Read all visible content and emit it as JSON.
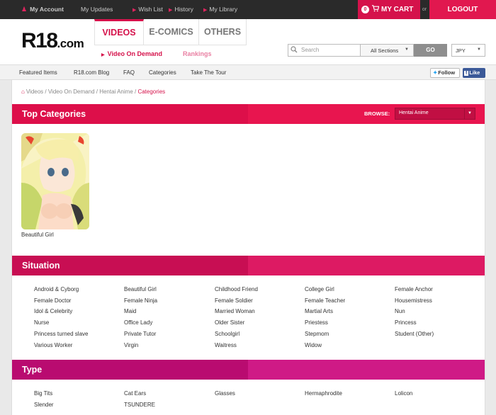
{
  "topbar": {
    "my_account": "My Account",
    "my_updates": "My Updates",
    "wish_list": "Wish List",
    "history": "History",
    "my_library": "My Library",
    "cart_count": "0",
    "my_cart": "MY CART",
    "or": "or",
    "logout": "LOGOUT"
  },
  "header": {
    "logo_main": "R18",
    "logo_suffix": ".com",
    "tabs": [
      "VIDEOS",
      "E-COMICS",
      "OTHERS"
    ],
    "subnav": [
      "Video On Demand",
      "Rankings"
    ],
    "search_placeholder": "Search",
    "section_select": "All Sections",
    "go_button": "GO",
    "currency": "JPY"
  },
  "secnav": {
    "items": [
      "Featured Items",
      "R18.com Blog",
      "FAQ",
      "Categories",
      "Take The Tour"
    ],
    "follow": "Follow",
    "like": "Like"
  },
  "breadcrumb": [
    "Videos",
    "Video On Demand",
    "Hentai Anime",
    "Categories"
  ],
  "top_categories": {
    "title": "Top Categories",
    "browse_label": "BROWSE:",
    "browse_value": "Hentai Anime",
    "items": [
      {
        "label": "Beautiful Girl"
      }
    ]
  },
  "situation": {
    "title": "Situation",
    "items": [
      "Android & Cyborg",
      "Beautiful Girl",
      "Childhood Friend",
      "College Girl",
      "Female Anchor",
      "Female Doctor",
      "Female Ninja",
      "Female Soldier",
      "Female Teacher",
      "Housemistress",
      "Idol & Celebrity",
      "Maid",
      "Married Woman",
      "Martial Arts",
      "Nun",
      "Nurse",
      "Office Lady",
      "Older Sister",
      "Priestess",
      "Princess",
      "Princess turned slave",
      "Private Tutor",
      "Schoolgirl",
      "Stepmom",
      "Student (Other)",
      "Various Worker",
      "Virgin",
      "Waitress",
      "Widow"
    ]
  },
  "type": {
    "title": "Type",
    "items": [
      "Big Tits",
      "Cat Ears",
      "Glasses",
      "Hermaphrodite",
      "Lolicon",
      "Slender",
      "TSUNDERE"
    ]
  },
  "colors": {
    "accent": "#d5124b",
    "top_dark": "#dd0f4a",
    "top_light": "#e8154f",
    "situation_dark": "#c80e53",
    "situation_light": "#dd1a63",
    "type_dark": "#b90b70",
    "type_light": "#cf1a86"
  }
}
